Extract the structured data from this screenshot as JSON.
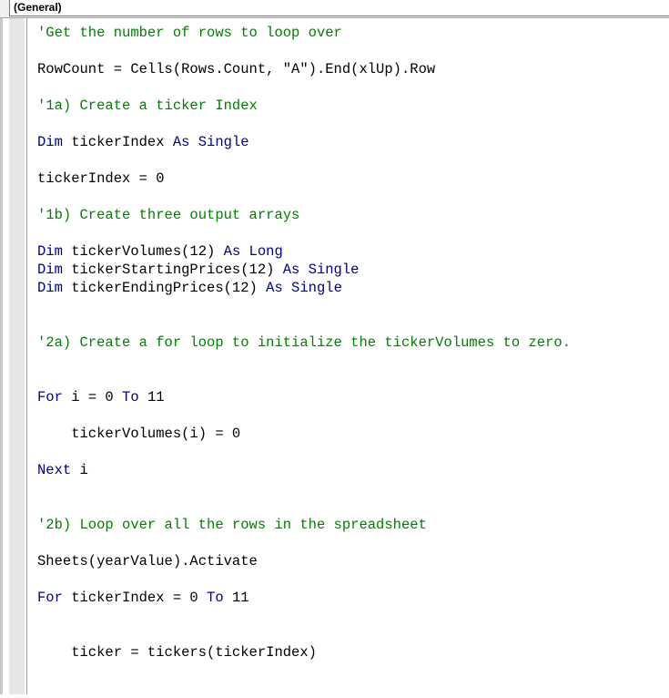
{
  "procedure_dropdown": {
    "value": "(General)"
  },
  "code_lines": [
    {
      "segments": [
        {
          "t": "'Get the number of rows to loop over",
          "c": "comment"
        }
      ]
    },
    {
      "segments": []
    },
    {
      "segments": [
        {
          "t": "RowCount = Cells(Rows.Count, \"A\").End(xlUp).Row",
          "c": "plain"
        }
      ]
    },
    {
      "segments": []
    },
    {
      "segments": [
        {
          "t": "'1a) Create a ticker Index",
          "c": "comment"
        }
      ]
    },
    {
      "segments": []
    },
    {
      "segments": [
        {
          "t": "Dim",
          "c": "keyword"
        },
        {
          "t": " tickerIndex ",
          "c": "plain"
        },
        {
          "t": "As Single",
          "c": "keyword"
        }
      ]
    },
    {
      "segments": []
    },
    {
      "segments": [
        {
          "t": "tickerIndex = 0",
          "c": "plain"
        }
      ]
    },
    {
      "segments": []
    },
    {
      "segments": [
        {
          "t": "'1b) Create three output arrays",
          "c": "comment"
        }
      ]
    },
    {
      "segments": []
    },
    {
      "segments": [
        {
          "t": "Dim",
          "c": "keyword"
        },
        {
          "t": " tickerVolumes(12) ",
          "c": "plain"
        },
        {
          "t": "As Long",
          "c": "keyword"
        }
      ]
    },
    {
      "segments": [
        {
          "t": "Dim",
          "c": "keyword"
        },
        {
          "t": " tickerStartingPrices(12) ",
          "c": "plain"
        },
        {
          "t": "As Single",
          "c": "keyword"
        }
      ]
    },
    {
      "segments": [
        {
          "t": "Dim",
          "c": "keyword"
        },
        {
          "t": " tickerEndingPrices(12) ",
          "c": "plain"
        },
        {
          "t": "As Single",
          "c": "keyword"
        }
      ]
    },
    {
      "segments": []
    },
    {
      "segments": []
    },
    {
      "segments": [
        {
          "t": "'2a) Create a for loop to initialize the tickerVolumes to zero.",
          "c": "comment"
        }
      ]
    },
    {
      "segments": []
    },
    {
      "segments": []
    },
    {
      "segments": [
        {
          "t": "For",
          "c": "keyword"
        },
        {
          "t": " i = 0 ",
          "c": "plain"
        },
        {
          "t": "To",
          "c": "keyword"
        },
        {
          "t": " 11",
          "c": "plain"
        }
      ]
    },
    {
      "segments": []
    },
    {
      "segments": [
        {
          "t": "    tickerVolumes(i) = 0",
          "c": "plain"
        }
      ]
    },
    {
      "segments": []
    },
    {
      "segments": [
        {
          "t": "Next",
          "c": "keyword"
        },
        {
          "t": " i",
          "c": "plain"
        }
      ]
    },
    {
      "segments": []
    },
    {
      "segments": []
    },
    {
      "segments": [
        {
          "t": "'2b) Loop over all the rows in the spreadsheet",
          "c": "comment"
        }
      ]
    },
    {
      "segments": []
    },
    {
      "segments": [
        {
          "t": "Sheets(yearValue).Activate",
          "c": "plain"
        }
      ]
    },
    {
      "segments": []
    },
    {
      "segments": [
        {
          "t": "For",
          "c": "keyword"
        },
        {
          "t": " tickerIndex = 0 ",
          "c": "plain"
        },
        {
          "t": "To",
          "c": "keyword"
        },
        {
          "t": " 11",
          "c": "plain"
        }
      ]
    },
    {
      "segments": []
    },
    {
      "segments": []
    },
    {
      "segments": [
        {
          "t": "    ticker = tickers(tickerIndex)",
          "c": "plain"
        }
      ]
    },
    {
      "segments": []
    },
    {
      "segments": []
    }
  ],
  "colors": {
    "comment": "#008000",
    "keyword": "#00008b",
    "plain": "#000000"
  }
}
